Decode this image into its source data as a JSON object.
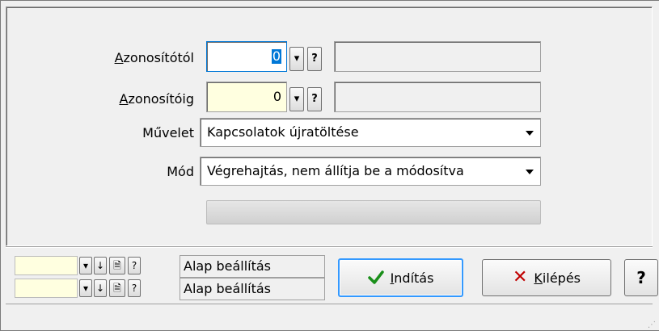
{
  "form": {
    "id_from_label_pre": "A",
    "id_from_label_rest": "zonosítótól",
    "id_from_value": "0",
    "id_to_label_pre": "A",
    "id_to_label_rest": "zonosítóig",
    "id_to_value": "0",
    "dropdown_btn": "▾",
    "help_btn": "?",
    "operation_label": "Művelet",
    "operation_value": "Kapcsolatok újratöltése",
    "mode_label": "Mód",
    "mode_value": "Végrehajtás, nem állítja be a módosítva",
    "progress": 0
  },
  "settings_rows": [
    {
      "dropdown": "▾",
      "down": "↓",
      "doc": "🗎",
      "help": "?",
      "label": "Alap beállítás"
    },
    {
      "dropdown": "▾",
      "down": "↓",
      "doc": "🗎",
      "help": "?",
      "label": "Alap beállítás"
    }
  ],
  "buttons": {
    "start_label_pre": "I",
    "start_label_rest": "ndítás",
    "exit_label_pre": "K",
    "exit_label_rest": "ilépés",
    "help_label": "?"
  }
}
